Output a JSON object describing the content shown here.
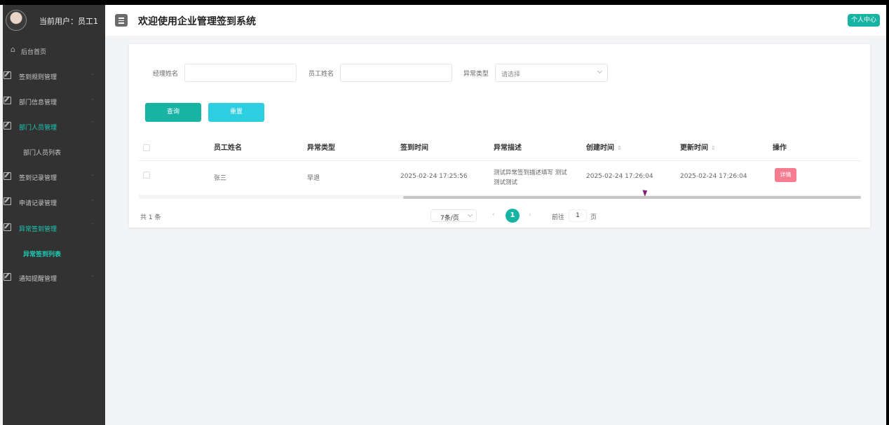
{
  "sidebar": {
    "user_label": "当前用户：员工1",
    "home": "后台首页",
    "menu": [
      {
        "label": "签到规则管理"
      },
      {
        "label": "部门信息管理"
      },
      {
        "label": "部门人员管理"
      },
      {
        "label": "部门人员列表"
      },
      {
        "label": "签到记录管理"
      },
      {
        "label": "申请记录管理"
      },
      {
        "label": "异常签到管理"
      },
      {
        "label": "异常签到列表"
      },
      {
        "label": "通知提醒管理"
      }
    ]
  },
  "header": {
    "title": "欢迎使用企业管理签到系统",
    "profile": "个人中心"
  },
  "search": {
    "manager_label": "经理姓名",
    "employee_label": "员工姓名",
    "type_label": "异常类型",
    "type_placeholder": "请选择",
    "query": "查询",
    "reset": "重置"
  },
  "table": {
    "headers": [
      "员工姓名",
      "异常类型",
      "签到时间",
      "异常描述",
      "创建时间",
      "更新时间",
      "操作"
    ],
    "rows": [
      {
        "employee": "张三",
        "type": "早退",
        "sign_time": "2025-02-24 17:25:56",
        "desc_line1": "测试异常签到描述填写 测试",
        "desc_line2": "测试测试",
        "created": "2025-02-24 17:26:04",
        "updated": "2025-02-24 17:26:04",
        "action": "详情"
      }
    ]
  },
  "pagination": {
    "total": "共 1 条",
    "page_size": "7条/页",
    "current": "1",
    "goto_label": "前往",
    "goto_value": "1",
    "page_unit": "页"
  },
  "colors": {
    "accent": "#17b3a3",
    "sidebar_bg": "#323232",
    "active_text": "#1ccab5",
    "detail_button": "#f57d8f"
  }
}
